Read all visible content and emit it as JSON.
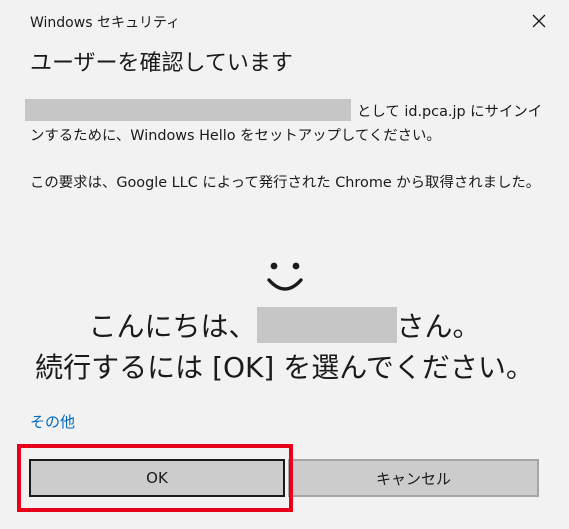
{
  "window": {
    "title": "Windows セキュリティ"
  },
  "heading": "ユーザーを確認しています",
  "message1": {
    "text_after_email": "として id.pca.jp にサインインするために、Windows Hello をセットアップしてください。"
  },
  "message2": "この要求は、Google LLC によって発行された Chrome から取得されました。",
  "greeting": {
    "line1_prefix": "こんにちは、",
    "line1_suffix": "さん。",
    "line2": "続行するには [OK] を選んでください。"
  },
  "more_link": "その他",
  "buttons": {
    "ok": "OK",
    "cancel": "キャンセル"
  },
  "colors": {
    "background": "#f2f2f2",
    "link": "#0067c0",
    "button": "#cccccc",
    "redaction": "#c6c6c6",
    "highlight": "#e8001a"
  }
}
